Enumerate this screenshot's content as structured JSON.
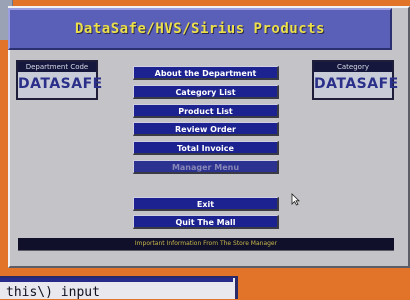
{
  "app": {
    "title": "DataSafe/HVS/Sirius Products"
  },
  "department_code": {
    "caption": "Department Code",
    "value": "DATASAFE"
  },
  "category": {
    "caption": "Category",
    "value": "DATASAFE"
  },
  "menu": {
    "about": "About the Department",
    "category_list": "Category List",
    "product_list": "Product List",
    "review_order": "Review Order",
    "total_invoice": "Total Invoice",
    "manager_menu": "Manager Menu",
    "exit": "Exit",
    "quit_mall": "Quit The Mall"
  },
  "ticker": {
    "text": "Important Information From The Store Manager"
  },
  "bottom_window": {
    "text": "this\\) input"
  },
  "colors": {
    "desktop": "#e2742a",
    "panel": "#c4c4c8",
    "title_bg": "#5a5fb8",
    "title_text": "#ece04a",
    "button_bg": "#1c2290",
    "code_value": "#2a2f8a"
  },
  "icons": {
    "cursor": "arrow-cursor-icon"
  }
}
